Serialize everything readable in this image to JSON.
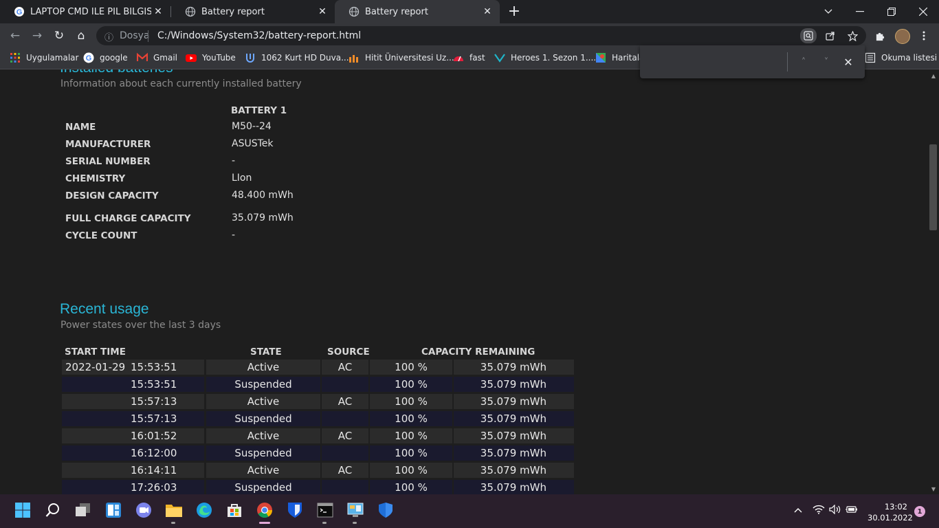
{
  "tabs": [
    {
      "title": "LAPTOP CMD İLE PİL BİLGİSİ ALMA",
      "close": "✕"
    },
    {
      "title": "Battery report",
      "close": "✕"
    },
    {
      "title": "Battery report",
      "close": "✕"
    }
  ],
  "window": {
    "new_tab": "+",
    "minimize": "⌄",
    "restore": "❐",
    "maximize_hint": "–",
    "close": "✕"
  },
  "toolbar": {
    "back": "←",
    "forward": "→",
    "reload": "↻",
    "home": "⌂"
  },
  "address": {
    "info_icon": "ⓘ",
    "scheme_label": "Dosya",
    "url": "C:/Windows/System32/battery-report.html"
  },
  "bookmarks": [
    {
      "label": "Uygulamalar",
      "icon": "apps-grid-icon"
    },
    {
      "label": "google",
      "icon": "google-icon"
    },
    {
      "label": "Gmail",
      "icon": "gmail-icon"
    },
    {
      "label": "YouTube",
      "icon": "youtube-icon"
    },
    {
      "label": "1062 Kurt HD Duva...",
      "icon": "site-icon"
    },
    {
      "label": "Hitit Üniversitesi Uz...",
      "icon": "site-icon"
    },
    {
      "label": "fast",
      "icon": "speedometer-icon"
    },
    {
      "label": "Heroes 1. Sezon 1....",
      "icon": "site-icon"
    },
    {
      "label": "Haritala",
      "icon": "maps-icon"
    }
  ],
  "reading_list": "Okuma listesi",
  "findbar": {
    "prev": "˄",
    "next": "˅",
    "close": "✕"
  },
  "installed": {
    "heading": "Installed batteries",
    "subtitle": "Information about each currently installed battery",
    "column_header": "BATTERY 1",
    "rows": [
      {
        "label": "NAME",
        "value": "M50--24"
      },
      {
        "label": "MANUFACTURER",
        "value": "ASUSTek"
      },
      {
        "label": "SERIAL NUMBER",
        "value": "-"
      },
      {
        "label": "CHEMISTRY",
        "value": "LIon"
      },
      {
        "label": "DESIGN CAPACITY",
        "value": "48.400 mWh"
      },
      {
        "label": "FULL CHARGE CAPACITY",
        "value": "35.079 mWh"
      },
      {
        "label": "CYCLE COUNT",
        "value": "-"
      }
    ]
  },
  "recent": {
    "heading": "Recent usage",
    "subtitle": "Power states over the last 3 days",
    "headers": [
      "START TIME",
      "STATE",
      "SOURCE",
      "CAPACITY REMAINING"
    ],
    "rows": [
      {
        "date": "2022-01-29",
        "time": "15:53:51",
        "state": "Active",
        "source": "AC",
        "percent": "100 %",
        "mwh": "35.079 mWh"
      },
      {
        "date": "",
        "time": "15:53:51",
        "state": "Suspended",
        "source": "",
        "percent": "100 %",
        "mwh": "35.079 mWh"
      },
      {
        "date": "",
        "time": "15:57:13",
        "state": "Active",
        "source": "AC",
        "percent": "100 %",
        "mwh": "35.079 mWh"
      },
      {
        "date": "",
        "time": "15:57:13",
        "state": "Suspended",
        "source": "",
        "percent": "100 %",
        "mwh": "35.079 mWh"
      },
      {
        "date": "",
        "time": "16:01:52",
        "state": "Active",
        "source": "AC",
        "percent": "100 %",
        "mwh": "35.079 mWh"
      },
      {
        "date": "",
        "time": "16:12:00",
        "state": "Suspended",
        "source": "",
        "percent": "100 %",
        "mwh": "35.079 mWh"
      },
      {
        "date": "",
        "time": "16:14:11",
        "state": "Active",
        "source": "AC",
        "percent": "100 %",
        "mwh": "35.079 mWh"
      },
      {
        "date": "",
        "time": "17:26:03",
        "state": "Suspended",
        "source": "",
        "percent": "100 %",
        "mwh": "35.079 mWh"
      }
    ]
  },
  "taskbar": {
    "apps": [
      "windows-start-icon",
      "search-icon",
      "task-view-icon",
      "widgets-icon",
      "teams-chat-icon",
      "file-explorer-icon",
      "edge-icon",
      "store-icon",
      "chrome-icon",
      "bitwarden-icon",
      "terminal-icon",
      "control-panel-icon",
      "defender-icon"
    ],
    "time": "13:02",
    "date": "30.01.2022",
    "notifications": "1"
  },
  "colors": {
    "accent_heading": "#2ab6d6",
    "row_odd": "#2b2b2b",
    "row_even": "#1a1a2e",
    "taskbar": "#2a1f2c"
  }
}
